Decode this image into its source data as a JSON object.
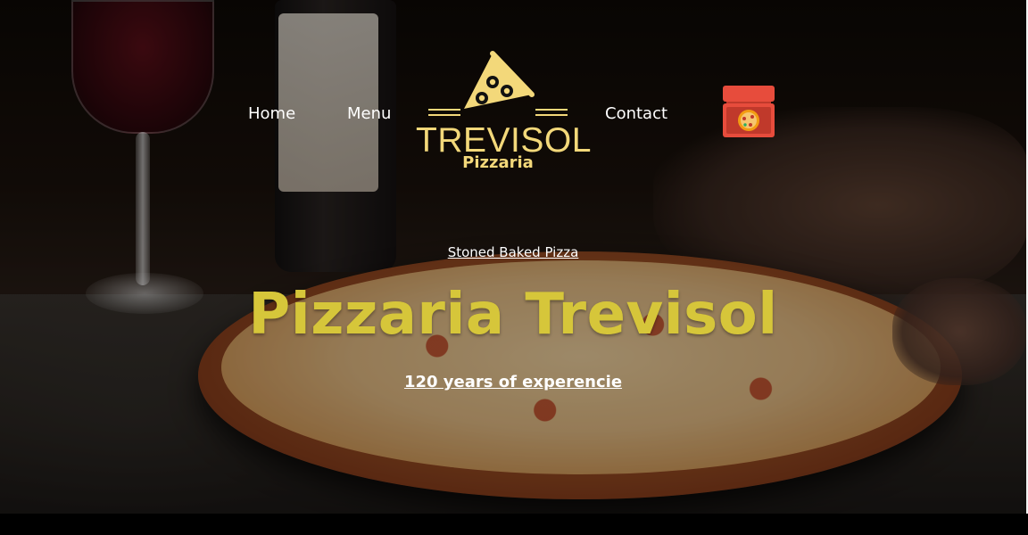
{
  "nav": {
    "items": [
      {
        "label": "Home"
      },
      {
        "label": "Menu"
      },
      {
        "label": "Contact"
      }
    ]
  },
  "logo": {
    "title": "TREVISOL",
    "subtitle": "Pizzaria",
    "icon": "pizza-slice-icon",
    "color": "#f3d87a"
  },
  "cart": {
    "icon": "pizza-box-cart-icon",
    "color": "#e74c3c"
  },
  "hero": {
    "eyebrow": "Stoned Baked Pizza",
    "title": "Pizzaria Trevisol",
    "subtitle": "120 years of experencie",
    "title_color": "#d6c63a"
  }
}
